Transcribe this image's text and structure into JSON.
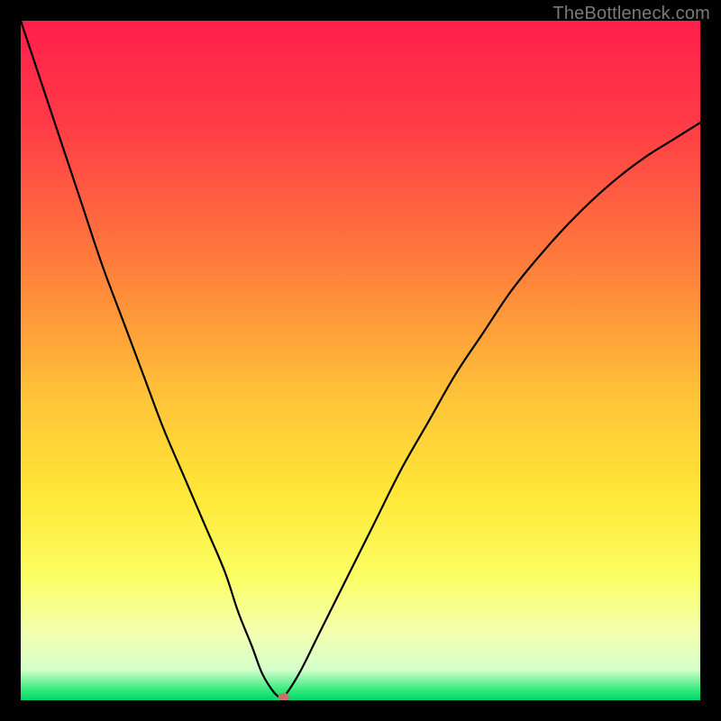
{
  "watermark": "TheBottleneck.com",
  "chart_data": {
    "type": "line",
    "title": "",
    "xlabel": "",
    "ylabel": "",
    "xlim": [
      0,
      100
    ],
    "ylim": [
      0,
      100
    ],
    "gradient_stops": [
      {
        "offset": 0.0,
        "color": "#ff1f4b"
      },
      {
        "offset": 0.15,
        "color": "#ff3b47"
      },
      {
        "offset": 0.35,
        "color": "#ff7a3c"
      },
      {
        "offset": 0.55,
        "color": "#ffc238"
      },
      {
        "offset": 0.7,
        "color": "#ffe838"
      },
      {
        "offset": 0.82,
        "color": "#fbff66"
      },
      {
        "offset": 0.9,
        "color": "#f4ffb0"
      },
      {
        "offset": 0.955,
        "color": "#d4ffca"
      },
      {
        "offset": 0.985,
        "color": "#34ea7b"
      },
      {
        "offset": 1.0,
        "color": "#00d66a"
      }
    ],
    "series": [
      {
        "name": "bottleneck-curve",
        "x": [
          0,
          3,
          6,
          9,
          12,
          15,
          18,
          21,
          24,
          27,
          30,
          32,
          34,
          35.5,
          37,
          38,
          38.7,
          41,
          44,
          48,
          52,
          56,
          60,
          64,
          68,
          72,
          76,
          80,
          84,
          88,
          92,
          96,
          100
        ],
        "values": [
          100,
          91,
          82,
          73,
          64,
          56,
          48,
          40,
          33,
          26,
          19,
          13,
          8,
          4,
          1.5,
          0.5,
          0.5,
          4,
          10,
          18,
          26,
          34,
          41,
          48,
          54,
          60,
          65,
          69.5,
          73.5,
          77,
          80,
          82.5,
          85
        ]
      }
    ],
    "marker": {
      "x": 38.7,
      "y": 0.5,
      "color": "#c6736a"
    },
    "legend": []
  }
}
